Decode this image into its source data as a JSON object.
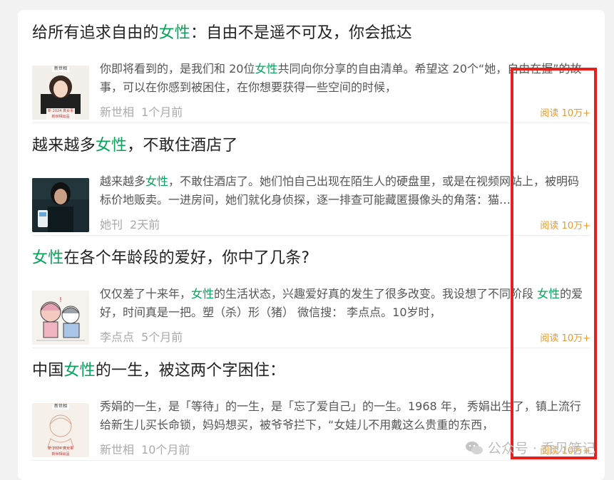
{
  "articles": [
    {
      "title_pre": "给所有追求自由的",
      "title_hl": "女性",
      "title_post": "：自由不是遥不可及，你会抵达",
      "desc_pre": "你即将看到的，是我们和 20位",
      "desc_hl": "女性",
      "desc_post": "共同向你分享的自由清单。希望这 20个“她，自由在握”的故事，可以在你感到被困住，在你想要获得一些空间的时候，",
      "source": "新世相",
      "time": "1个月前",
      "reads": "阅读 10万+",
      "thumb": {
        "label_top": "新世相",
        "label_mid": "新 2024 真女事",
        "label_bot": "新世相出品"
      }
    },
    {
      "title_pre": "越来越多",
      "title_hl": "女性",
      "title_post": "，不敢住酒店了",
      "desc_pre": "越来越多",
      "desc_hl": "女性",
      "desc_post": "，不敢住酒店了。她们怕自己出现在陌生人的硬盘里，或是在视频网站上，被明码标价地贩卖。一进房间，她们就化身侦探，逐一排查可能藏匿摄像头的角落：猫…",
      "source": "她刊",
      "time": "2天前",
      "reads": "阅读 10万+"
    },
    {
      "title_pre": "",
      "title_hl": "女性",
      "title_post": "在各个年龄段的爱好，你中了几条?",
      "desc_pre": "仅仅差了十来年，",
      "desc_hl": "女性",
      "desc_post": "的生活状态，兴趣爱好真的发生了很多改变。我设想了不同阶段 ",
      "desc_hl2": "女性",
      "desc_post2": "的爱好，时间真是一把。塑（杀）形（猪） 微信搜： 李点点。10岁时，",
      "source": "李点点",
      "time": "5个月前",
      "reads": "阅读 10万+"
    },
    {
      "title_pre": "中国",
      "title_hl": "女性",
      "title_post": "的一生，被这两个字困住：",
      "desc_pre": "秀娟的一生，是「等待」的一生，是「忘了爱自己」的一生。1968 年， 秀娟出生了，镇上流行给新生儿买长命锁，妈妈想买，被爷爷拦下，“女娃儿不用戴这么贵重的东西，",
      "source": "新世相",
      "time": "10个月前",
      "reads": "阅读 10万+",
      "thumb": {
        "label_top": "新世相",
        "label_mid": "新 2024 真女事",
        "label_bot": "新世相出品"
      }
    }
  ],
  "watermark": {
    "text": "公众号 · 乔贝笔记"
  },
  "colors": {
    "highlight": "#07a35a",
    "reads": "#e99a2a",
    "annotation_box": "#e8201c"
  }
}
